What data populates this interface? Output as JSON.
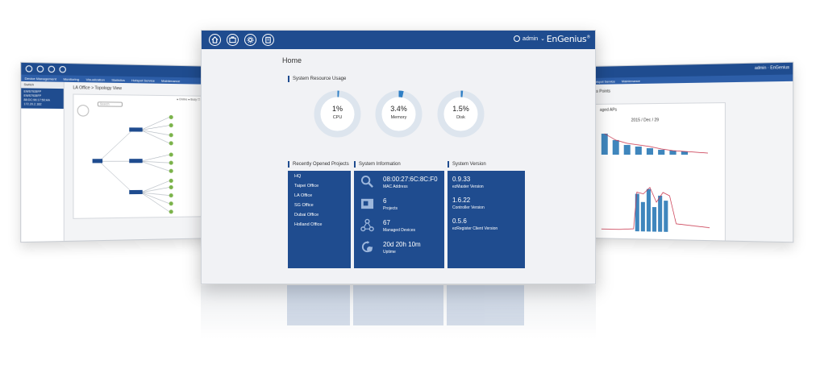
{
  "left_screen": {
    "nav": [
      "Device Management",
      "Monitoring",
      "Visualization",
      "Statistics",
      "Hotspot Service",
      "Maintenance"
    ],
    "sidebar_header": "Switch",
    "switch_card": [
      "EWS7928FP",
      "EWS7928FP",
      "88:DC:96:17:50:AA",
      "172.20.2.182"
    ],
    "title": "LA Office > Topology View",
    "legend": "● Online  ● Busy   ☐ Show Port",
    "search_placeholder": "Search"
  },
  "right_screen": {
    "brand": "EnGenius",
    "user": "admin",
    "nav": [
      "Hotspot Service",
      "Maintenance"
    ],
    "title": "ss Points",
    "subtitle": "aged APs",
    "date": "2015 / Dec / 29"
  },
  "main": {
    "topbar": {
      "icons": [
        "home-icon",
        "projects-icon",
        "settings-icon",
        "building-icon"
      ],
      "user": "admin",
      "brand": "EnGenius",
      "brand_mark": "®"
    },
    "page_title": "Home",
    "resource": {
      "title": "System Resource Usage",
      "gauges": [
        {
          "label": "CPU",
          "value": "1%",
          "fraction": 0.01
        },
        {
          "label": "Memory",
          "value": "3.4%",
          "fraction": 0.034
        },
        {
          "label": "Disk",
          "value": "1.5%",
          "fraction": 0.015
        }
      ]
    },
    "projects": {
      "title": "Recently Opened Projects",
      "items": [
        "HQ",
        "Taipei Office",
        "LA Office",
        "SG Office",
        "Dubai Office",
        "Holland Office"
      ]
    },
    "system_info": {
      "title": "System Information",
      "rows": [
        {
          "icon": "search-icon",
          "value": "08:00:27:6C:8C:F0",
          "label": "MAC Address"
        },
        {
          "icon": "projects-icon",
          "value": "6",
          "label": "Projects"
        },
        {
          "icon": "network-icon",
          "value": "67",
          "label": "Managed Devices"
        },
        {
          "icon": "uptime-icon",
          "value": "20d 20h 10m",
          "label": "Uptime"
        }
      ]
    },
    "system_version": {
      "title": "System Version",
      "rows": [
        {
          "value": "0.9.33",
          "label": "ezMaster Version"
        },
        {
          "value": "1.6.22",
          "label": "Controller Version"
        },
        {
          "value": "0.5.6",
          "label": "ezRegister Client Version"
        }
      ]
    },
    "colors": {
      "primary": "#1f4c8f",
      "gauge_track": "#dde5ee",
      "gauge_fill": "#2f7fc5"
    }
  }
}
